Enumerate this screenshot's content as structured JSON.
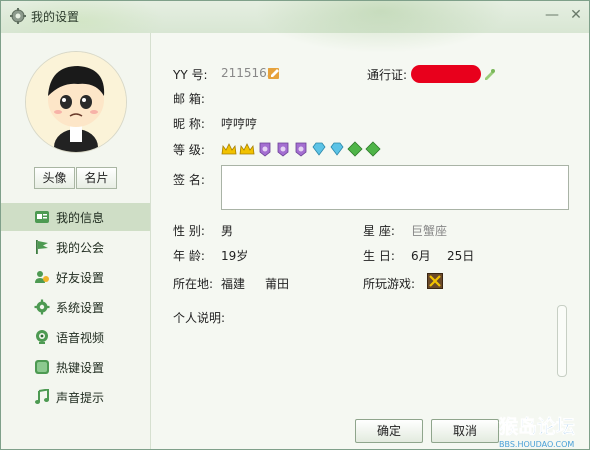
{
  "window": {
    "title": "我的设置",
    "minimize_glyph": "—",
    "close_glyph": "✕"
  },
  "sidebar": {
    "avatar_button": "头像",
    "card_button": "名片",
    "items": [
      {
        "label": "我的信息",
        "icon": "id-card-icon",
        "active": true
      },
      {
        "label": "我的公会",
        "icon": "flag-icon",
        "active": false
      },
      {
        "label": "好友设置",
        "icon": "friends-icon",
        "active": false
      },
      {
        "label": "系统设置",
        "icon": "gear-icon",
        "active": false
      },
      {
        "label": "语音视频",
        "icon": "webcam-icon",
        "active": false
      },
      {
        "label": "热键设置",
        "icon": "hotkey-icon",
        "active": false
      },
      {
        "label": "声音提示",
        "icon": "music-note-icon",
        "active": false
      }
    ]
  },
  "profile": {
    "yy_label": "YY 号:",
    "yy_value": "2115163",
    "passport_label": "通行证:",
    "email_label": "邮  箱:",
    "email_value": "",
    "nickname_label": "昵  称:",
    "nickname_value": "哼哼哼",
    "level_label": "等  级:",
    "level_badges": [
      "crown-icon",
      "crown-icon",
      "purple-medal-icon",
      "purple-medal-icon",
      "purple-medal-icon",
      "blue-diamond-icon",
      "blue-diamond-icon",
      "green-leaf-icon",
      "green-leaf-icon"
    ],
    "signature_label": "签  名:",
    "signature_value": "",
    "gender_label": "性  别:",
    "gender_value": "男",
    "zodiac_label": "星  座:",
    "zodiac_value": "巨蟹座",
    "age_label": "年  龄:",
    "age_value": "19岁",
    "birthday_label": "生  日:",
    "birthday_month": "6月",
    "birthday_day": "25日",
    "location_label": "所在地:",
    "location_province": "福建",
    "location_city": "莆田",
    "games_label": "所玩游戏:",
    "bio_label": "个人说明:",
    "bio_value": ""
  },
  "buttons": {
    "ok": "确定",
    "cancel": "取消"
  },
  "watermark": {
    "main": "猴岛论坛",
    "url": "BBS.HOUDAO.COM"
  },
  "colors": {
    "accent_green": "#cfdec6",
    "redaction": "#e8001c"
  }
}
